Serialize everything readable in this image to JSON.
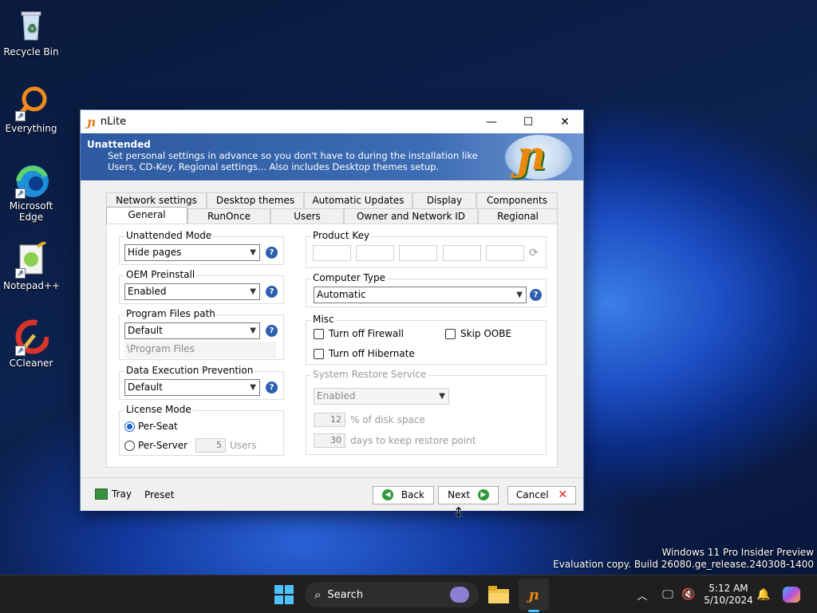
{
  "desktop": {
    "icons": [
      {
        "label": "Recycle Bin",
        "icon": "recycle-bin-icon"
      },
      {
        "label": "Everything",
        "icon": "everything-icon"
      },
      {
        "label": "Microsoft Edge",
        "icon": "edge-icon"
      },
      {
        "label": "Notepad++",
        "icon": "notepadpp-icon"
      },
      {
        "label": "CCleaner",
        "icon": "ccleaner-icon"
      }
    ]
  },
  "window": {
    "title": "nLite",
    "logo": "ɲ",
    "controls": {
      "minimize": "—",
      "maximize": "☐",
      "close": "✕"
    },
    "header": {
      "title": "Unattended",
      "description": "Set personal settings in advance so you don't have to during the installation like Users, CD-Key, Regional settings... Also includes Desktop themes setup."
    },
    "tabs_back": [
      "Network settings",
      "Desktop themes",
      "Automatic Updates",
      "Display",
      "Components"
    ],
    "tabs_front": [
      "General",
      "RunOnce",
      "Users",
      "Owner and Network ID",
      "Regional"
    ],
    "active_tab": "General",
    "general": {
      "unattended_mode": {
        "label": "Unattended Mode",
        "value": "Hide pages"
      },
      "oem_preinstall": {
        "label": "OEM Preinstall",
        "value": "Enabled"
      },
      "program_files": {
        "label": "Program Files path",
        "value": "Default",
        "path": "\\Program Files"
      },
      "dep": {
        "label": "Data Execution Prevention",
        "value": "Default"
      },
      "license": {
        "label": "License Mode",
        "per_seat": "Per-Seat",
        "per_server": "Per-Server",
        "users_value": "5",
        "users_label": "Users",
        "selected": "Per-Seat"
      },
      "product_key": {
        "label": "Product Key"
      },
      "computer_type": {
        "label": "Computer Type",
        "value": "Automatic"
      },
      "misc": {
        "label": "Misc",
        "firewall": "Turn off Firewall",
        "skip_oobe": "Skip OOBE",
        "hibernate": "Turn off Hibernate"
      },
      "system_restore": {
        "label": "System Restore Service",
        "value": "Enabled",
        "disk_value": "12",
        "disk_label": "% of disk space",
        "days_value": "30",
        "days_label": "days to keep restore point"
      }
    },
    "footer": {
      "tray": "Tray",
      "preset": "Preset",
      "back": "Back",
      "next": "Next",
      "cancel": "Cancel"
    }
  },
  "taskbar": {
    "search": "Search",
    "time": "5:12 AM",
    "date": "5/10/2024"
  },
  "watermark": {
    "line1": "Windows 11 Pro Insider Preview",
    "line2": "Evaluation copy. Build 26080.ge_release.240308-1400"
  },
  "colors": {
    "header_blue": "#2d5aa0",
    "accent": "#1a5fd0",
    "taskbar": "#1f1f1f"
  }
}
